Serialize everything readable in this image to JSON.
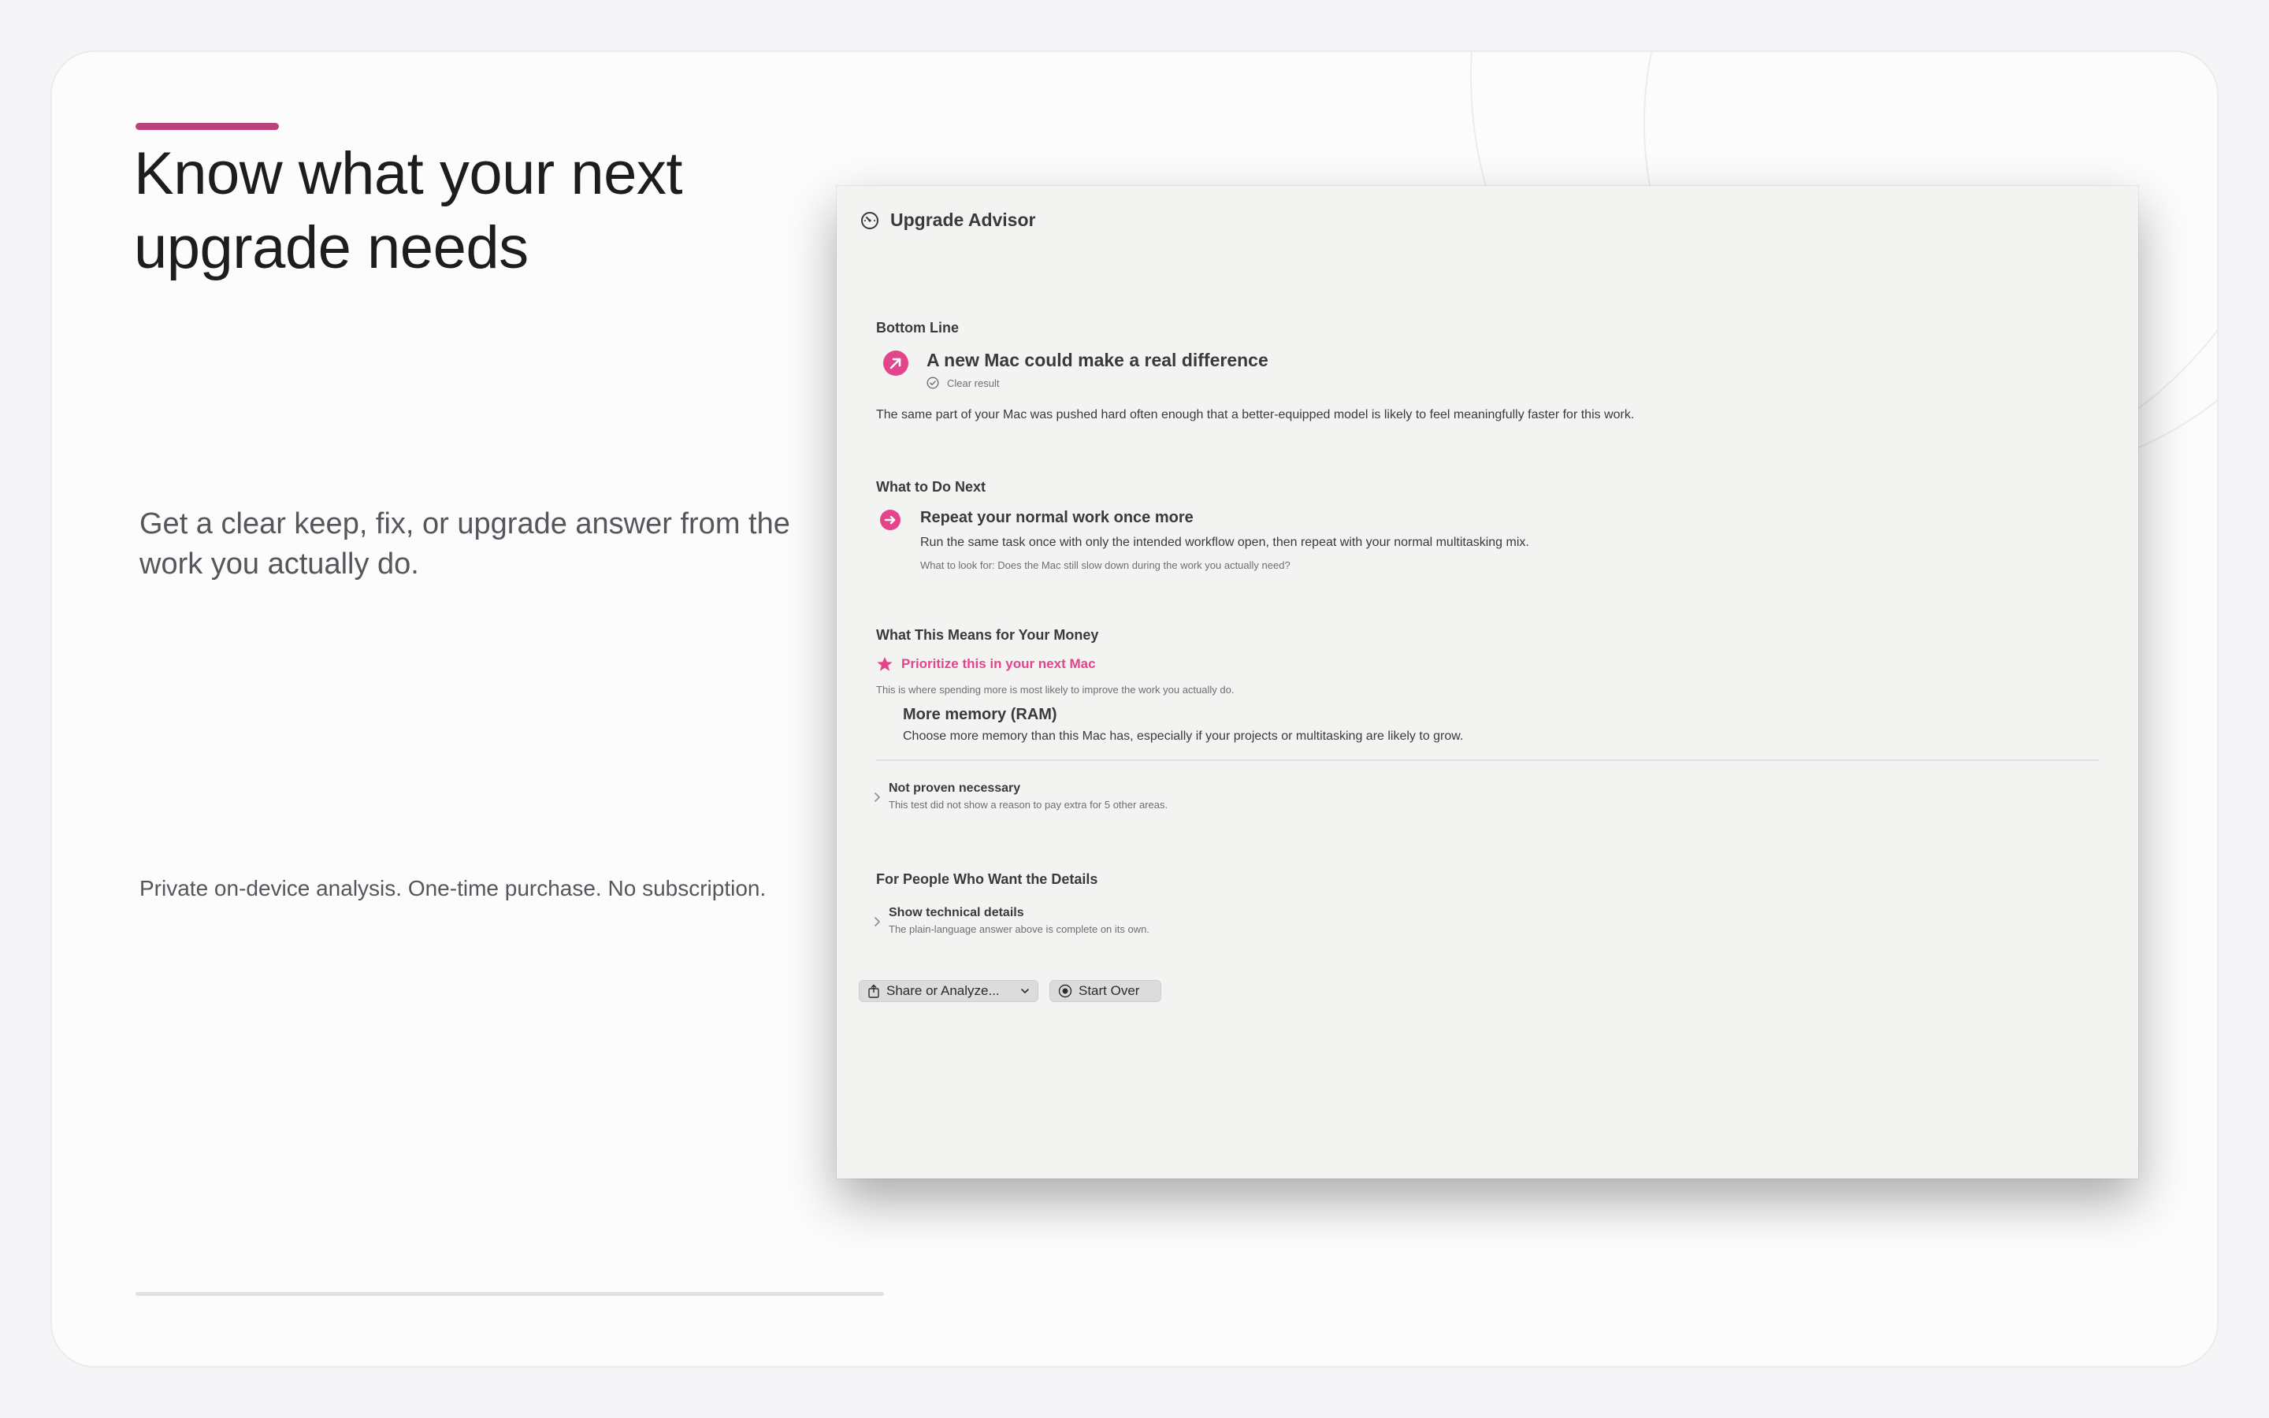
{
  "hero": {
    "headline_line1": "Know what your next",
    "headline_line2": "upgrade needs",
    "subhead_line1": "Get a clear keep, fix, or upgrade answer from the",
    "subhead_line2": "work you actually do.",
    "footnote": "Private on-device analysis. One-time purchase. No subscription."
  },
  "window": {
    "title": "Upgrade Advisor",
    "bottom_line": {
      "heading": "Bottom Line",
      "title": "A new Mac could make a real difference",
      "badge": "Clear result",
      "description": "The same part of your Mac was pushed hard often enough that a better-equipped model is likely to feel meaningfully faster for this work."
    },
    "next": {
      "heading": "What to Do Next",
      "title": "Repeat your normal work once more",
      "description": "Run the same task once with only the intended workflow open, then repeat with your normal multitasking mix.",
      "hint": "What to look for: Does the Mac still slow down during the work you actually need?"
    },
    "money": {
      "heading": "What This Means for Your Money",
      "priority_label": "Prioritize this in your next Mac",
      "priority_note": "This is where spending more is most likely to improve the work you actually do.",
      "item_title": "More memory (RAM)",
      "item_description": "Choose more memory than this Mac has, especially if your projects or multitasking are likely to grow.",
      "not_proven_title": "Not proven necessary",
      "not_proven_note": "This test did not show a reason to pay extra for 5 other areas."
    },
    "details": {
      "heading": "For People Who Want the Details",
      "toggle_title": "Show technical details",
      "toggle_note": "The plain-language answer above is complete on its own."
    },
    "buttons": {
      "share": "Share or Analyze...",
      "start_over": "Start Over"
    }
  },
  "colors": {
    "accent": "#b8427a",
    "pink": "#e4448a"
  }
}
